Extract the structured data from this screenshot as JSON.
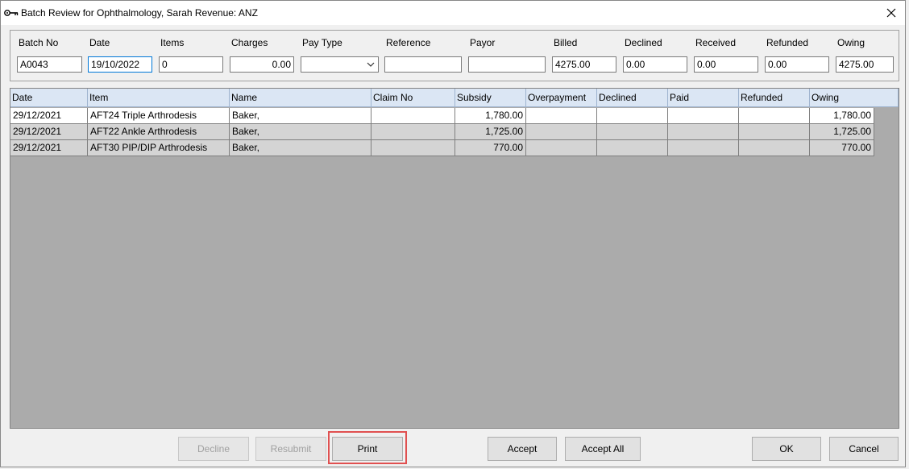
{
  "window": {
    "title": "Batch Review for Ophthalmology, Sarah Revenue: ANZ"
  },
  "header": {
    "batch_no": {
      "label": "Batch No",
      "value": "A0043"
    },
    "date": {
      "label": "Date",
      "value": "19/10/2022"
    },
    "items": {
      "label": "Items",
      "value": "0"
    },
    "charges": {
      "label": "Charges",
      "value": "0.00"
    },
    "pay_type": {
      "label": "Pay Type",
      "value": ""
    },
    "reference": {
      "label": "Reference",
      "value": ""
    },
    "payor": {
      "label": "Payor",
      "value": ""
    },
    "billed": {
      "label": "Billed",
      "value": "4275.00"
    },
    "declined": {
      "label": "Declined",
      "value": "0.00"
    },
    "received": {
      "label": "Received",
      "value": "0.00"
    },
    "refunded": {
      "label": "Refunded",
      "value": "0.00"
    },
    "owing": {
      "label": "Owing",
      "value": "4275.00"
    }
  },
  "table": {
    "columns": [
      "Date",
      "Item",
      "Name",
      "Claim No",
      "Subsidy",
      "Overpayment",
      "Declined",
      "Paid",
      "Refunded",
      "Owing"
    ],
    "rows": [
      [
        "29/12/2021",
        "AFT24 Triple Arthrodesis",
        "Baker,",
        "",
        "1,780.00",
        "",
        "",
        "",
        "",
        "1,780.00"
      ],
      [
        "29/12/2021",
        "AFT22 Ankle Arthrodesis",
        "Baker,",
        "",
        "1,725.00",
        "",
        "",
        "",
        "",
        "1,725.00"
      ],
      [
        "29/12/2021",
        "AFT30 PIP/DIP Arthrodesis",
        "Baker,",
        "",
        "770.00",
        "",
        "",
        "",
        "",
        "770.00"
      ]
    ]
  },
  "buttons": {
    "decline": "Decline",
    "resubmit": "Resubmit",
    "print": "Print",
    "accept": "Accept",
    "accept_all": "Accept All",
    "ok": "OK",
    "cancel": "Cancel"
  },
  "icons": {
    "title": "key-icon",
    "close": "close-icon",
    "dropdown": "chevron-down-icon"
  },
  "colors": {
    "highlight": "#e05050",
    "grid_header": "#dbe6f4",
    "grid_background": "#ababab"
  }
}
